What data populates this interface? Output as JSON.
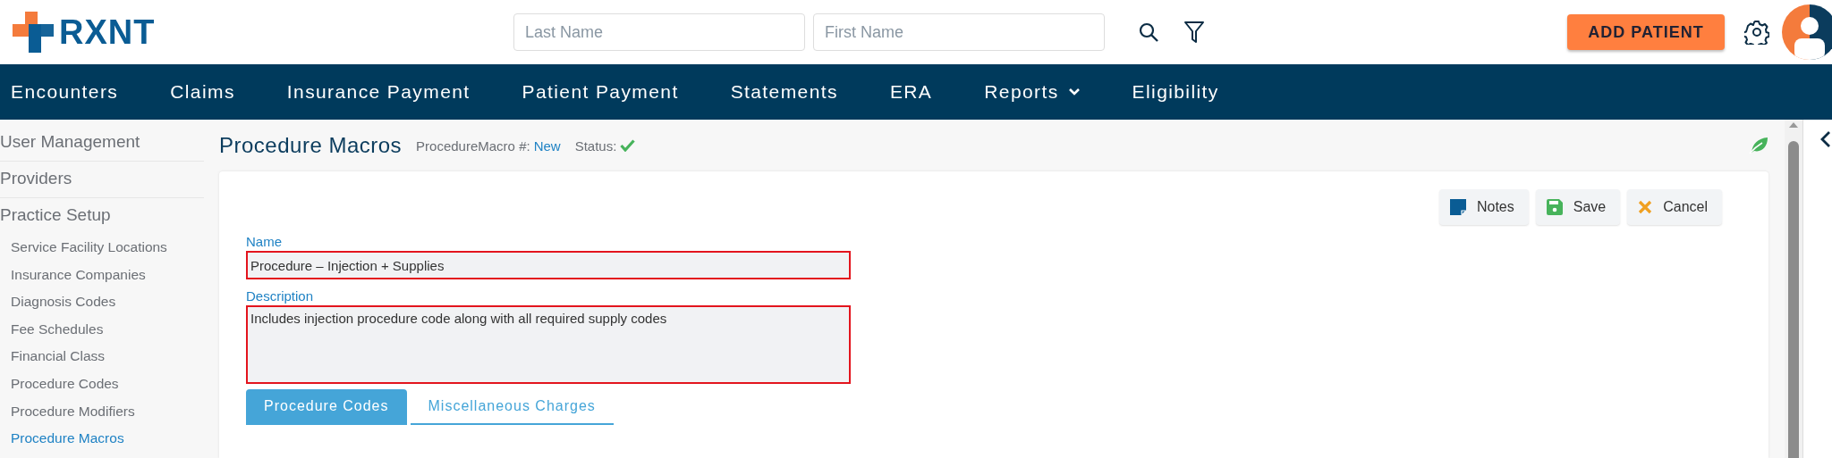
{
  "header": {
    "logo": "RXNT",
    "search_fields": [
      {
        "placeholder": "Last Name"
      },
      {
        "placeholder": "First Name"
      }
    ],
    "add_button": "ADD PATIENT"
  },
  "nav": {
    "items": [
      {
        "label": "Encounters",
        "has_menu": false
      },
      {
        "label": "Claims",
        "has_menu": false
      },
      {
        "label": "Insurance Payment",
        "has_menu": false
      },
      {
        "label": "Patient Payment",
        "has_menu": false
      },
      {
        "label": "Statements",
        "has_menu": false
      },
      {
        "label": "ERA",
        "has_menu": false
      },
      {
        "label": "Reports",
        "has_menu": true
      },
      {
        "label": "Eligibility",
        "has_menu": false
      }
    ]
  },
  "sidebar": {
    "items": [
      {
        "label": "User Management",
        "selected": false
      },
      {
        "label": "Providers",
        "selected": false
      },
      {
        "label": "Practice Setup",
        "selected": false,
        "children": [
          {
            "label": "Service Facility Locations",
            "selected": false
          },
          {
            "label": "Insurance Companies",
            "selected": false
          },
          {
            "label": "Diagnosis Codes",
            "selected": false
          },
          {
            "label": "Fee Schedules",
            "selected": false
          },
          {
            "label": "Financial Class",
            "selected": false
          },
          {
            "label": "Procedure Codes",
            "selected": false
          },
          {
            "label": "Procedure Modifiers",
            "selected": false
          },
          {
            "label": "Procedure Macros",
            "selected": true
          }
        ]
      }
    ]
  },
  "page": {
    "title": "Procedure Macros",
    "record_label": "ProcedureMacro #:",
    "record_value": "New",
    "status_label": "Status:",
    "status_ok": true
  },
  "toolbar": {
    "buttons": [
      {
        "kind": "notes",
        "label": "Notes"
      },
      {
        "kind": "save",
        "label": "Save"
      },
      {
        "kind": "cancel",
        "label": "Cancel"
      }
    ]
  },
  "form": {
    "fields": [
      {
        "kind": "input",
        "label": "Name",
        "value": "Procedure – Injection + Supplies",
        "error": true
      },
      {
        "kind": "textarea",
        "label": "Description",
        "value": "Includes injection procedure code along with all required supply codes",
        "error": true
      }
    ]
  },
  "tabs": [
    {
      "label": "Procedure Codes",
      "selected": true
    },
    {
      "label": "Miscellaneous Charges",
      "selected": false
    }
  ]
}
